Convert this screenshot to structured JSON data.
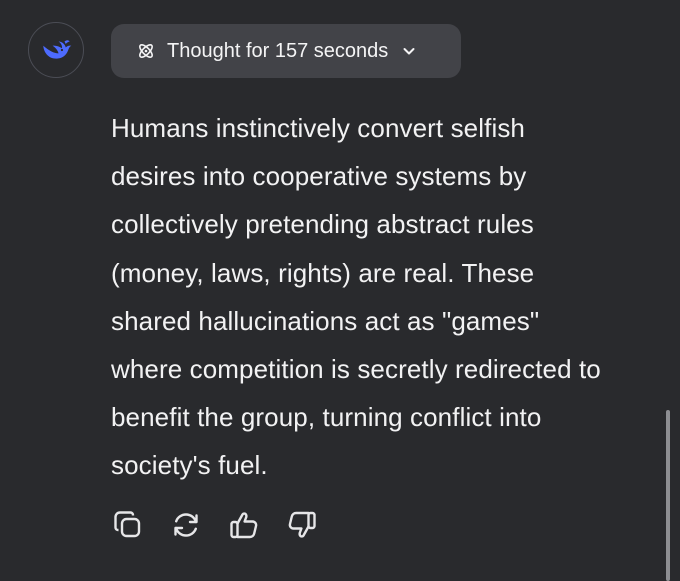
{
  "thought": {
    "label": "Thought for 157 seconds"
  },
  "answer": {
    "lines": [
      "Humans instinctively convert selfish",
      "desires into cooperative systems by",
      "collectively pretending abstract rules",
      "(money, laws, rights) are real. These",
      "shared hallucinations act as \"games\"",
      "where competition is secretly redirected to",
      "benefit the group, turning conflict into",
      "society's fuel."
    ]
  },
  "icons": {
    "avatar": "deepseek-whale-logo",
    "thought": "atom-icon",
    "toggle": "chevron-down-icon",
    "actions": [
      "copy-icon",
      "regenerate-icon",
      "thumbs-up-icon",
      "thumbs-down-icon"
    ]
  },
  "colors": {
    "background": "#292a2d",
    "pill": "#424348",
    "text": "#f2f2f3",
    "brand": "#4d6bfe"
  }
}
